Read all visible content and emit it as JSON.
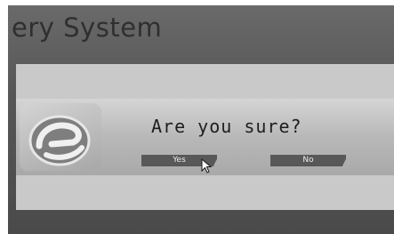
{
  "background": {
    "title_fragment": "ery System"
  },
  "dialog": {
    "question": "Are you sure?",
    "yes_label": "Yes",
    "no_label": "No",
    "logo_icon": "stylized-e-logo",
    "cursor_icon": "mouse-pointer-arrow"
  },
  "colors": {
    "screen_bg": "#565656",
    "dialog_bg": "#c9c9c9",
    "button_bg": "#585858",
    "button_text": "#eeeeee"
  }
}
